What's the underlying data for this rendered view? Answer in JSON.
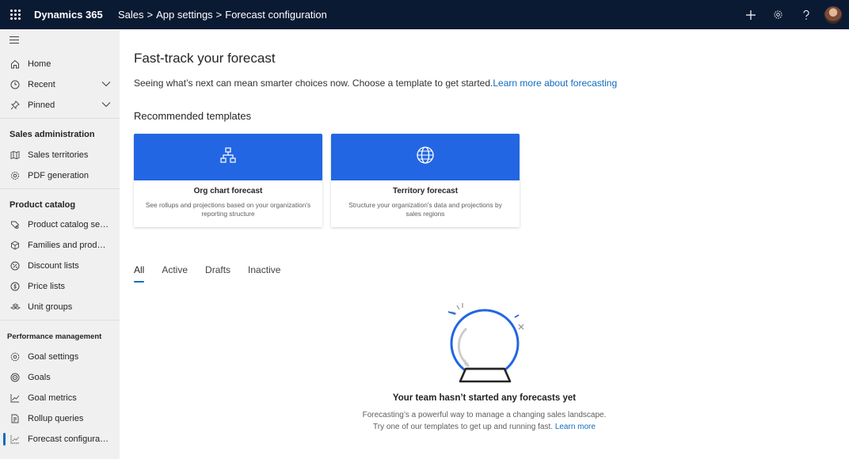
{
  "header": {
    "app_name": "Dynamics 365",
    "breadcrumb": [
      "Sales",
      ">",
      "App settings",
      ">",
      "Forecast configuration"
    ],
    "icons": [
      "waffle-icon",
      "plus-icon",
      "settings-icon",
      "help-icon",
      "avatar"
    ]
  },
  "sidebar": {
    "top_items": [
      {
        "label": "Home",
        "icon": "home-icon"
      },
      {
        "label": "Recent",
        "icon": "clock-icon"
      },
      {
        "label": "Pinned",
        "icon": "pin-icon"
      }
    ],
    "sales_admin_heading": "Sales administration",
    "sales_admin": [
      {
        "label": "Sales territories",
        "icon": "map-icon"
      },
      {
        "label": "PDF generation",
        "icon": "gear-icon"
      }
    ],
    "product_catalog_heading": "Product catalog",
    "product_catalog": [
      {
        "label": "Product catalog setti...",
        "icon": "catalog-settings-icon"
      },
      {
        "label": "Families and products",
        "icon": "box-icon"
      },
      {
        "label": "Discount lists",
        "icon": "percent-icon"
      },
      {
        "label": "Price lists",
        "icon": "dollar-icon"
      },
      {
        "label": "Unit groups",
        "icon": "unit-groups-icon"
      }
    ],
    "performance_heading": "Performance management",
    "performance": [
      {
        "label": "Goal settings",
        "icon": "goal-settings-icon"
      },
      {
        "label": "Goals",
        "icon": "target-icon"
      },
      {
        "label": "Goal metrics",
        "icon": "chart-line-icon"
      },
      {
        "label": "Rollup queries",
        "icon": "rollup-icon"
      },
      {
        "label": "Forecast configuration",
        "icon": "forecast-icon"
      }
    ]
  },
  "main": {
    "title": "Fast-track your forecast",
    "subtitle": "Seeing what’s next can mean smarter choices now. Choose a template to get started.",
    "learn_more_link": "Learn more about forecasting",
    "recommended_heading": "Recommended templates",
    "templates": [
      {
        "title": "Org chart forecast",
        "description": "See rollups and projections based on your organization's reporting structure",
        "icon": "org-chart-icon"
      },
      {
        "title": "Territory forecast",
        "description": "Structure your organization's data and projections by sales regions",
        "icon": "globe-icon"
      }
    ],
    "tabs": [
      "All",
      "Active",
      "Drafts",
      "Inactive"
    ],
    "active_tab": "All",
    "empty_state": {
      "heading": "Your team hasn’t started any forecasts yet",
      "line1": "Forecasting’s a powerful way to manage a changing sales landscape.",
      "line2": "Try one of our templates to get up and running fast.",
      "link": "Learn more"
    }
  },
  "colors": {
    "topbar": "#0b1a33",
    "accent": "#2266e3",
    "link": "#0f6cbd",
    "sidebar_bg": "#f0f0f0"
  }
}
